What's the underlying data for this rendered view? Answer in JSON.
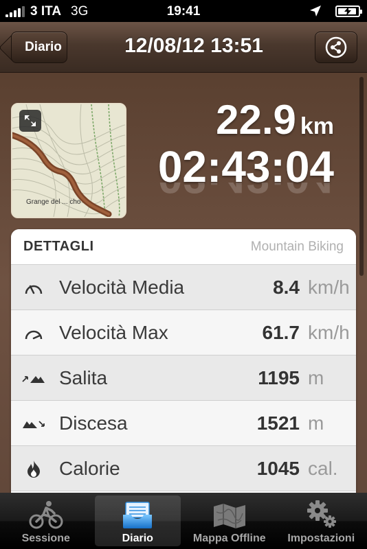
{
  "status_bar": {
    "carrier": "3 ITA",
    "network": "3G",
    "time": "19:41"
  },
  "nav": {
    "back_label": "Diario",
    "title": "12/08/12 13:51"
  },
  "summary": {
    "distance_value": "22.9",
    "distance_unit": "km",
    "duration": "02:43:04",
    "map_label": "Grange del ... cho"
  },
  "details": {
    "title": "DETTAGLI",
    "activity": "Mountain Biking",
    "rows": [
      {
        "icon": "speedometer-avg-icon",
        "label": "Velocità Media",
        "value": "8.4",
        "unit": "km/h"
      },
      {
        "icon": "speedometer-max-icon",
        "label": "Velocità Max",
        "value": "61.7",
        "unit": "km/h"
      },
      {
        "icon": "ascent-icon",
        "label": "Salita",
        "value": "1195",
        "unit": "m"
      },
      {
        "icon": "descent-icon",
        "label": "Discesa",
        "value": "1521",
        "unit": "m"
      },
      {
        "icon": "flame-icon",
        "label": "Calorie",
        "value": "1045",
        "unit": "cal."
      }
    ]
  },
  "tabs": [
    {
      "label": "Sessione",
      "icon": "cyclist-icon",
      "active": false
    },
    {
      "label": "Diario",
      "icon": "inbox-tray-icon",
      "active": true
    },
    {
      "label": "Mappa Offline",
      "icon": "folded-map-icon",
      "active": false
    },
    {
      "label": "Impostazioni",
      "icon": "gears-icon",
      "active": false
    }
  ],
  "colors": {
    "nav_brown": "#4a382d",
    "content_brown": "#6f5242",
    "tab_active_blue": "#2f8fe0"
  }
}
